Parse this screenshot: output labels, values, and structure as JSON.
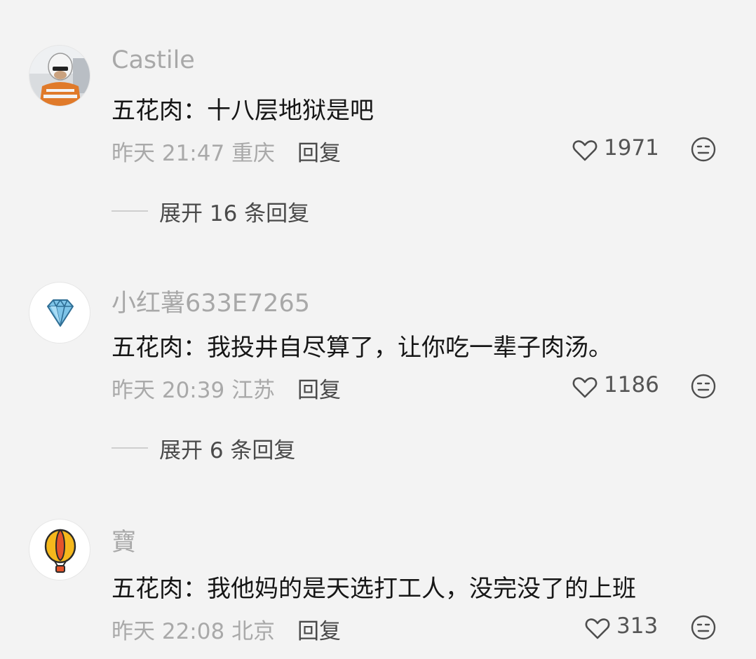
{
  "comments": [
    {
      "username": "Castile",
      "content": "五花肉：十八层地狱是吧",
      "time": "昨天 21:47",
      "location": "重庆",
      "reply_label": "回复",
      "likes": "1971",
      "expand_label": "展开 16 条回复",
      "avatar_icon": "photo-avatar"
    },
    {
      "username": "小红薯633E7265",
      "content": "五花肉：我投井自尽算了，让你吃一辈子肉汤。",
      "time": "昨天 20:39",
      "location": "江苏",
      "reply_label": "回复",
      "likes": "1186",
      "expand_label": "展开 6 条回复",
      "avatar_icon": "diamond-icon"
    },
    {
      "username": "寶",
      "content": "五花肉：我他妈的是天选打工人，没完没了的上班",
      "time": "昨天 22:08",
      "location": "北京",
      "reply_label": "回复",
      "likes": "313",
      "avatar_icon": "hot-air-balloon-icon"
    }
  ],
  "colors": {
    "background": "#f3f3f3",
    "username": "#a8a8a8",
    "content": "#161616",
    "meta": "#a9a9a9"
  }
}
